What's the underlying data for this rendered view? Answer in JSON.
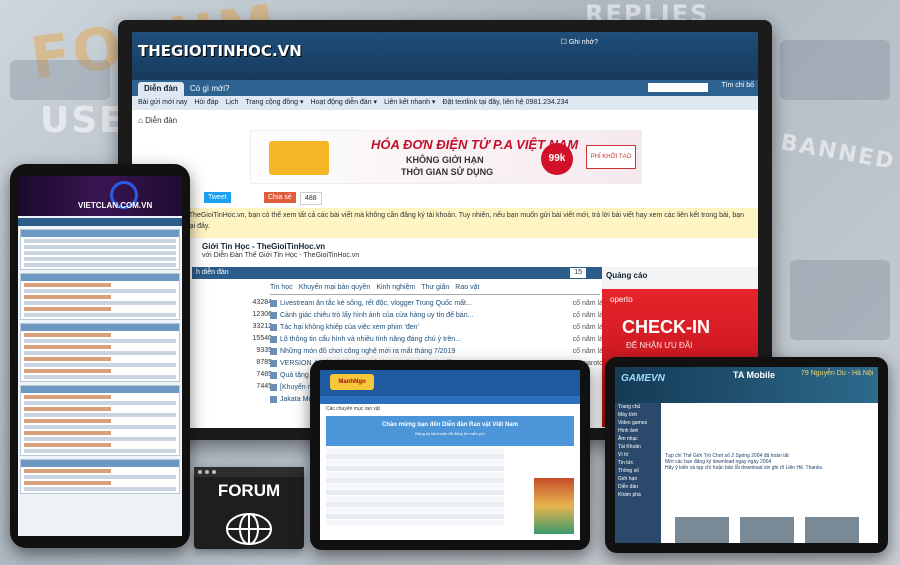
{
  "background_words": [
    "FORUM",
    "USER",
    "REPLIES",
    "BANNED"
  ],
  "monitor": {
    "logo": "THEGIOITINHOC.VN",
    "remember_label": "Ghi nhớ?",
    "tabs": [
      "Diễn đàn",
      "Có gì mới?"
    ],
    "sign_label": "Tìm chỉ bố",
    "nav": [
      "Bài gửi mới nay",
      "Hỏi đáp",
      "Lịch",
      "Trang cộng đồng ▾",
      "Hoạt động diễn đàn ▾",
      "Liên kết nhanh ▾",
      "Đặt textlink tại đây, liên hệ 0981.234.234"
    ],
    "breadcrumb": "Diễn đàn",
    "banner": {
      "title": "HÓA ĐƠN ĐIỆN TỬ P.A VIỆT NAM",
      "line1": "KHÔNG GIỚI HẠN",
      "line2": "THỜI GIAN SỬ DỤNG",
      "price": "99k",
      "cta": "PHÍ KHỞI TẠO"
    },
    "share": {
      "tweet": "Tweet",
      "share": "Chia sẻ",
      "count": "488"
    },
    "notice": "ếu bạn mới đến TheGioiTinHoc.vn, bạn có thể xem tất cả các bài viết mà không cần đăng ký tài khoản. Tuy nhiên, nếu bạn muốn gửi bài viết mới, trả lời bài viết hay xem các liên kết trong bài, bạn khoản miễn phí tại đây.",
    "forum_title": "Giới Tin Học - TheGioiTinHoc.vn",
    "forum_sub": "với Diễn Đàn Thế Giới Tin Học - TheGioiTinHoc.vn",
    "panel_head": "h diễn đàn",
    "panel_count": "15",
    "subtabs": [
      "Tin học",
      "Khuyến mại bản quyền",
      "Kinh nghiệm",
      "Thư giãn",
      "Rao vặt"
    ],
    "numbers": [
      "43284",
      "12306",
      "33212",
      "15540",
      "9335",
      "8785",
      "7485",
      "7445"
    ],
    "rows": [
      {
        "title": "Livestream ăn tắc kè sống, rết độc, vlogger Trung Quốc mất...",
        "who": "cố nâm lá"
      },
      {
        "title": "Cảnh giác chiêu trò lấy hình ảnh của cửa hàng uy tín để bán...",
        "who": "cố nâm lá"
      },
      {
        "title": "Tác hại không khiếp của việc xem phim 'đen'",
        "who": "cố nâm lá"
      },
      {
        "title": "Lộ thông tin cấu hình và nhiều tính năng đáng chú ý trên...",
        "who": "cố nâm lá"
      },
      {
        "title": "Những món đồ chơi công nghệ mới ra mắt tháng 7/2019",
        "who": "cố nâm lá"
      },
      {
        "title": "VERSION 4: Giúp kích hoạt Windows 10/8.1/8/7 và Office...",
        "who": "naroto"
      },
      {
        "title": "Quả tặng thành viên...",
        "who": ""
      },
      {
        "title": "[Khuyến mãi 72...",
        "who": ""
      },
      {
        "title": "Jakata Media Ba...",
        "who": ""
      }
    ],
    "ads": {
      "title": "Quảng cáo",
      "brand": "operto",
      "headline": "CHECK-IN",
      "sub": "ĐỂ NHẬN ƯU ĐÃI"
    }
  },
  "phone": {
    "site": "VIETCLAN.COM.VN"
  },
  "tablet_mid": {
    "logo": "ManhNgo",
    "crumb": "Các chuyên mục rao vặt",
    "hero_title": "Chào mừng bạn đến Diễn đàn Rao vặt Việt Nam",
    "hero_sub": "Đăng ký tài khoản để đăng tin miễn phí"
  },
  "tablet_right": {
    "logo": "GAMEVN",
    "ta": "TA Mobile",
    "ta2": "79 Nguyễn Du - Hà Nội",
    "nav": [
      "Trang chủ",
      "Máy tính",
      "Video games",
      "Hình ảnh",
      "Âm nhạc",
      "Tài Khoản",
      "Vì trí",
      "Tin tức",
      "Thông số",
      "Giới hạn",
      "Diễn đàn",
      "Khám phá"
    ],
    "news": [
      "Tạp chí Thế Giới Trò Chơi số 2 Spring 2004 đã hoàn tất",
      "Mời các bạn đăng ký download ngay ngày 2004",
      "Hãy ý kiến và tạp chí hoặc bảo lỗi download xin ghi rõ Liên Hệ. Thanks."
    ]
  },
  "forum_icon": {
    "label": "FORUM"
  },
  "colors": {
    "forum_blue": "#1f4f7a",
    "accent_red": "#c4102a",
    "device_black": "#111111"
  }
}
